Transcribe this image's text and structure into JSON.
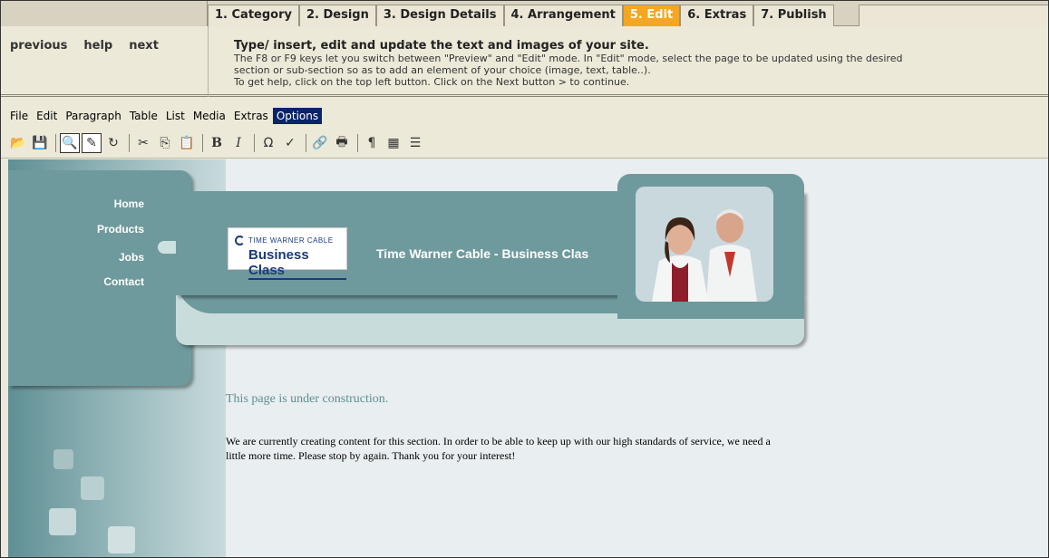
{
  "steps": [
    {
      "label": "1. Category",
      "active": false
    },
    {
      "label": "2. Design",
      "active": false
    },
    {
      "label": "3. Design Details",
      "active": false
    },
    {
      "label": "4. Arrangement",
      "active": false
    },
    {
      "label": "5. Edit",
      "active": true
    },
    {
      "label": "6. Extras",
      "active": false
    },
    {
      "label": "7. Publish",
      "active": false
    }
  ],
  "nav": {
    "previous": "previous",
    "help": "help",
    "next": "next"
  },
  "instructions": {
    "heading": "Type/ insert, edit and update the text and images of your site.",
    "line1": "The F8 or F9 keys let you switch between \"Preview\" and \"Edit\" mode. In \"Edit\" mode, select the page to be updated using the desired",
    "line2": "section or sub-section so as to add an element of your choice (image, text, table..).",
    "line3": "To get help, click on the top left button. Click on the Next button > to continue."
  },
  "menu": [
    "File",
    "Edit",
    "Paragraph",
    "Table",
    "List",
    "Media",
    "Extras",
    "Options"
  ],
  "menu_active": "Options",
  "toolbar": [
    "open-icon",
    "save-icon",
    "preview-icon",
    "edit-mode-icon",
    "refresh-icon",
    "cut-icon",
    "copy-icon",
    "paste-icon",
    "bold-icon",
    "italic-icon",
    "special-char-icon",
    "spellcheck-icon",
    "link-icon",
    "print-icon",
    "paragraph-icon",
    "table-icon",
    "list-icon"
  ],
  "site": {
    "nav": [
      "Home",
      "Products",
      "Jobs",
      "Contact"
    ],
    "logo_small": "TIME WARNER CABLE",
    "logo_big": "Business Class",
    "title": "Time Warner Cable - Business Clas",
    "construction_title": "This page is under construction.",
    "construction_body": "We are currently creating content for this section. In order to be able to keep up with our high standards of service, we need a little more time. Please stop by again. Thank you for your interest!"
  },
  "colors": {
    "active_step": "#f5a623",
    "teal": "#6e9a9d",
    "menu_active": "#0a246a"
  }
}
